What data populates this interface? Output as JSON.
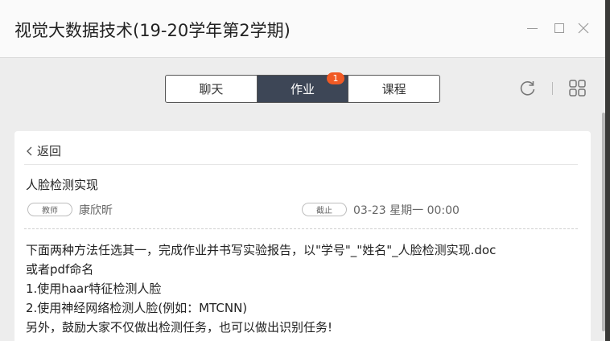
{
  "window": {
    "title": "视觉大数据技术(19-20学年第2学期)"
  },
  "tabs": [
    {
      "label": "聊天",
      "active": false
    },
    {
      "label": "作业",
      "active": true,
      "badge": "1"
    },
    {
      "label": "课程",
      "active": false
    }
  ],
  "toolbar": {
    "refresh_icon": "refresh-icon",
    "apps_icon": "grid-apps-icon"
  },
  "card": {
    "back_label": "返回",
    "homework_title": "人脸检测实现",
    "role_tag": "教师",
    "teacher_name": "康欣昕",
    "deadline_tag": "截止",
    "deadline_time": "03-23 星期一 00:00",
    "content_lines": [
      "下面两种方法任选其一，完成作业并书写实验报告，以\"学号\"_\"姓名\"_人脸检测实现.doc",
      "或者pdf命名",
      "1.使用haar特征检测人脸",
      "2.使用神经网络检测人脸(例如：MTCNN)",
      "另外，鼓励大家不仅做出检测任务，也可以做出识别任务!"
    ]
  },
  "colors": {
    "active_tab": "#3d4656",
    "badge": "#f15a24",
    "background": "#ededed"
  }
}
